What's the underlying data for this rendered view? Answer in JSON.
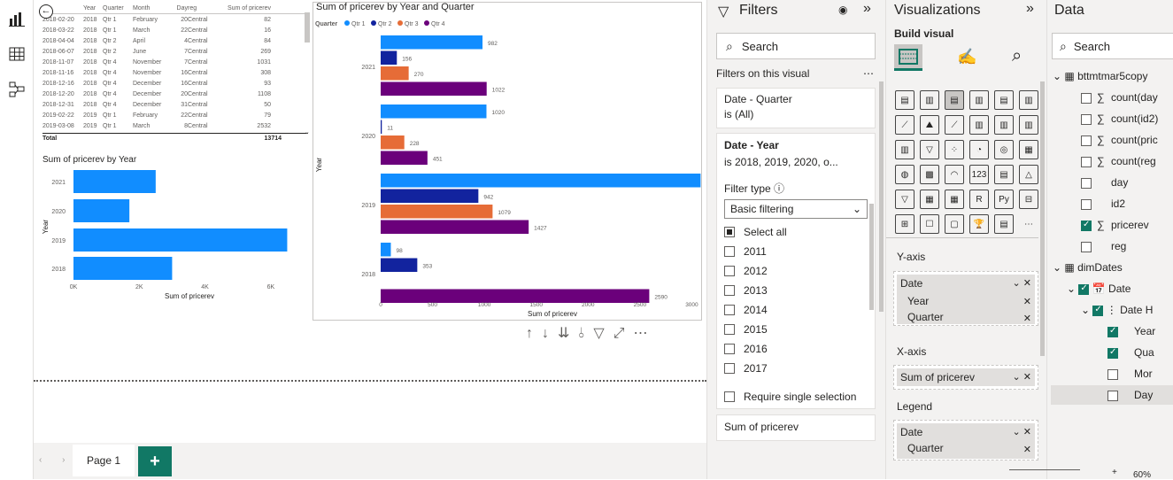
{
  "left_rail": {
    "icons": [
      "report-view-icon",
      "table-view-icon",
      "model-view-icon"
    ]
  },
  "table_visual": {
    "headers": [
      "...y",
      "Year",
      "Quarter",
      "Month",
      "Day",
      "reg",
      "Sum of pricerev"
    ],
    "rows": [
      [
        "2018-02-20",
        "2018",
        "Qtr 1",
        "February",
        "20",
        "Central",
        "82"
      ],
      [
        "2018-03-22",
        "2018",
        "Qtr 1",
        "March",
        "22",
        "Central",
        "16"
      ],
      [
        "2018-04-04",
        "2018",
        "Qtr 2",
        "April",
        "4",
        "Central",
        "84"
      ],
      [
        "2018-06-07",
        "2018",
        "Qtr 2",
        "June",
        "7",
        "Central",
        "269"
      ],
      [
        "2018-11-07",
        "2018",
        "Qtr 4",
        "November",
        "7",
        "Central",
        "1031"
      ],
      [
        "2018-11-16",
        "2018",
        "Qtr 4",
        "November",
        "16",
        "Central",
        "308"
      ],
      [
        "2018-12-16",
        "2018",
        "Qtr 4",
        "December",
        "16",
        "Central",
        "93"
      ],
      [
        "2018-12-20",
        "2018",
        "Qtr 4",
        "December",
        "20",
        "Central",
        "1108"
      ],
      [
        "2018-12-31",
        "2018",
        "Qtr 4",
        "December",
        "31",
        "Central",
        "50"
      ],
      [
        "2019-02-22",
        "2019",
        "Qtr 1",
        "February",
        "22",
        "Central",
        "79"
      ],
      [
        "2019-03-08",
        "2019",
        "Qtr 1",
        "March",
        "8",
        "Central",
        "2532"
      ]
    ],
    "total_label": "Total",
    "total_value": "13714"
  },
  "small_chart": {
    "title": "Sum of pricerev by Year"
  },
  "big_chart": {
    "title": "Sum of pricerev by Year and Quarter"
  },
  "chart_data": [
    {
      "type": "bar",
      "title": "Sum of pricerev by Year",
      "categories": [
        "2021",
        "2020",
        "2019",
        "2018"
      ],
      "values": [
        2500,
        1700,
        6500,
        3000
      ],
      "xlabel": "Sum of pricerev",
      "ylabel": "Year",
      "xticks": [
        "0K",
        "2K",
        "4K",
        "6K"
      ],
      "xlim": [
        0,
        7000
      ],
      "color": "#118DFF"
    },
    {
      "type": "bar",
      "title": "Sum of pricerev by Year and Quarter",
      "categories": [
        "2021",
        "2020",
        "2019",
        "2018"
      ],
      "legend_title": "Quarter",
      "series": [
        {
          "name": "Qtr 1",
          "color": "#118DFF",
          "values": [
            982,
            1020,
            3085,
            98
          ]
        },
        {
          "name": "Qtr 2",
          "color": "#12239E",
          "values": [
            156,
            11,
            942,
            353
          ]
        },
        {
          "name": "Qtr 3",
          "color": "#E66C37",
          "values": [
            270,
            228,
            1079,
            null
          ]
        },
        {
          "name": "Qtr 4",
          "color": "#6B007B",
          "values": [
            1022,
            451,
            1427,
            2590
          ]
        }
      ],
      "xlabel": "Sum of pricerev",
      "ylabel": "Year",
      "xticks": [
        "0",
        "500",
        "1000",
        "1500",
        "2000",
        "2500",
        "3000"
      ],
      "xlim": [
        0,
        3150
      ]
    }
  ],
  "visual_toolbar": {
    "icons": [
      "sort-up-icon",
      "sort-down-icon",
      "expand-all-icon",
      "drill-icon",
      "filter-icon",
      "focus-icon",
      "more-icon"
    ]
  },
  "bottom": {
    "page_tab": "Page 1",
    "add_label": "+"
  },
  "filters_pane": {
    "title": "Filters",
    "search_placeholder": "Search",
    "section_label": "Filters on this visual",
    "card1_title": "Date - Quarter",
    "card1_value": "is (All)",
    "card2_title": "Date - Year",
    "card2_value": "is 2018, 2019, 2020, o...",
    "filter_type_label": "Filter type",
    "filter_type_value": "Basic filtering",
    "select_all": "Select all",
    "years": [
      "2011",
      "2012",
      "2013",
      "2014",
      "2015",
      "2016",
      "2017"
    ],
    "require_single": "Require single selection",
    "card3_title": "Sum of pricerev"
  },
  "viz_pane": {
    "title": "Visualizations",
    "build_visual": "Build visual",
    "y_axis_label": "Y-axis",
    "y_field": "Date",
    "y_sub1": "Year",
    "y_sub2": "Quarter",
    "x_axis_label": "X-axis",
    "x_field": "Sum of pricerev",
    "legend_label": "Legend",
    "legend_field": "Date",
    "legend_sub": "Quarter"
  },
  "data_pane": {
    "title": "Data",
    "search_placeholder": "Search",
    "table1": "bttmtmar5copy",
    "fields1": [
      "count(day",
      "count(id2)",
      "count(pric",
      "count(reg",
      "day",
      "id2",
      "pricerev",
      "reg"
    ],
    "table2": "dimDates",
    "date_node": "Date",
    "date_hier": "Date H",
    "hier_items": [
      "Year",
      "Qua",
      "Mor",
      "Day"
    ]
  },
  "zoom": {
    "value": "60%"
  }
}
